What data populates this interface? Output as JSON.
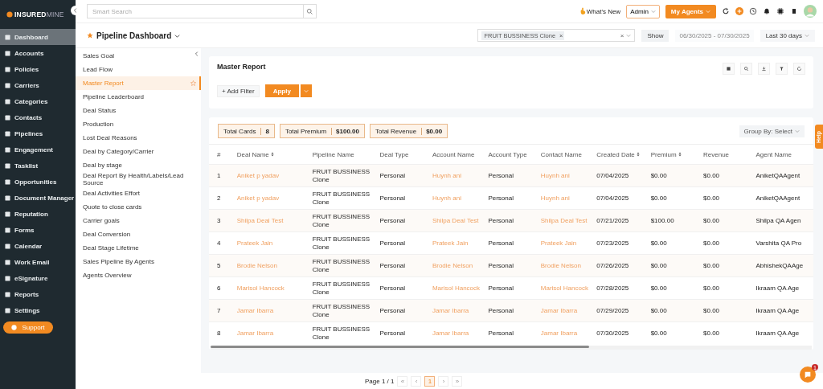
{
  "logo": {
    "bold": "INSURED",
    "light": "MINE"
  },
  "search": {
    "placeholder": "Smart Search"
  },
  "topbar": {
    "whats_new": "What's New",
    "role": "Admin",
    "agents_button": "My Agents"
  },
  "sidebar": {
    "items": [
      {
        "label": "Dashboard",
        "selected": true
      },
      {
        "label": "Accounts",
        "selected": false
      },
      {
        "label": "Policies",
        "selected": false
      },
      {
        "label": "Carriers",
        "selected": false
      },
      {
        "label": "Categories",
        "selected": false
      },
      {
        "label": "Contacts",
        "selected": false
      },
      {
        "label": "Pipelines",
        "selected": false
      },
      {
        "label": "Engagement",
        "selected": false
      },
      {
        "label": "Tasklist",
        "selected": false
      },
      {
        "label": "Opportunities",
        "selected": false
      },
      {
        "label": "Document Manager",
        "selected": false
      },
      {
        "label": "Reputation",
        "selected": false
      },
      {
        "label": "Forms",
        "selected": false
      },
      {
        "label": "Calendar",
        "selected": false
      },
      {
        "label": "Work Email",
        "selected": false
      },
      {
        "label": "eSignature",
        "selected": false
      },
      {
        "label": "Reports",
        "selected": false
      },
      {
        "label": "Settings",
        "selected": false
      }
    ],
    "support": "Support"
  },
  "header": {
    "title": "Pipeline Dashboard",
    "filter_tag": "FRUIT BUSSINESS Clone",
    "tag_remove": "×",
    "clear": "×",
    "show": "Show",
    "date_range": "06/30/2025 - 07/30/2025",
    "period": "Last 30 days"
  },
  "reports": [
    {
      "label": "Sales Goal",
      "selected": false,
      "starred": false
    },
    {
      "label": "Lead Flow",
      "selected": false,
      "starred": false
    },
    {
      "label": "Master Report",
      "selected": true,
      "starred": true
    },
    {
      "label": "Pipeline Leaderboard",
      "selected": false,
      "starred": false
    },
    {
      "label": "Deal Status",
      "selected": false,
      "starred": false
    },
    {
      "label": "Production",
      "selected": false,
      "starred": false
    },
    {
      "label": "Lost Deal Reasons",
      "selected": false,
      "starred": false
    },
    {
      "label": "Deal by Category/Carrier",
      "selected": false,
      "starred": false
    },
    {
      "label": "Deal by stage",
      "selected": false,
      "starred": false
    },
    {
      "label": "Deal Report By Health/Labels/Lead Source",
      "selected": false,
      "starred": false
    },
    {
      "label": "Deal Activities Effort",
      "selected": false,
      "starred": false
    },
    {
      "label": "Quote to close cards",
      "selected": false,
      "starred": false
    },
    {
      "label": "Carrier goals",
      "selected": false,
      "starred": false
    },
    {
      "label": "Deal Conversion",
      "selected": false,
      "starred": false
    },
    {
      "label": "Deal Stage Lifetime",
      "selected": false,
      "starred": false
    },
    {
      "label": "Sales Pipeline By Agents",
      "selected": false,
      "starred": false
    },
    {
      "label": "Agents Overview",
      "selected": false,
      "starred": false
    }
  ],
  "report": {
    "title": "Master Report",
    "add_filter": "+ Add Filter",
    "apply": "Apply"
  },
  "totals": [
    {
      "label": "Total Cards",
      "value": "8"
    },
    {
      "label": "Total Premium",
      "value": "$100.00"
    },
    {
      "label": "Total Revenue",
      "value": "$0.00"
    }
  ],
  "group_by": "Group By: Select",
  "help": "Help",
  "table": {
    "columns": [
      {
        "label": "#",
        "sortable": false
      },
      {
        "label": "Deal Name",
        "sortable": true
      },
      {
        "label": "Pipeline Name",
        "sortable": false
      },
      {
        "label": "Deal Type",
        "sortable": false
      },
      {
        "label": "Account Name",
        "sortable": false
      },
      {
        "label": "Account Type",
        "sortable": false
      },
      {
        "label": "Contact Name",
        "sortable": false
      },
      {
        "label": "Created Date",
        "sortable": true
      },
      {
        "label": "Premium",
        "sortable": true
      },
      {
        "label": "Revenue",
        "sortable": false
      },
      {
        "label": "Agent Name",
        "sortable": false
      }
    ],
    "rows": [
      [
        "1",
        "Aniket p yadav",
        "FRUIT BUSSINESS Clone",
        "Personal",
        "Huynh ani",
        "Personal",
        "Huynh ani",
        "07/04/2025",
        "$0.00",
        "$0.00",
        "AniketQAAgent"
      ],
      [
        "2",
        "Aniket p yadav",
        "FRUIT BUSSINESS Clone",
        "Personal",
        "Huynh ani",
        "Personal",
        "Huynh ani",
        "07/04/2025",
        "$0.00",
        "$0.00",
        "AniketQAAgent"
      ],
      [
        "3",
        "Shilpa Deal Test",
        "FRUIT BUSSINESS Clone",
        "Personal",
        "Shilpa Deal Test",
        "Personal",
        "Shilpa Deal Test",
        "07/21/2025",
        "$100.00",
        "$0.00",
        "Shilpa QA Agen"
      ],
      [
        "4",
        "Prateek Jain",
        "FRUIT BUSSINESS Clone",
        "Personal",
        "Prateek Jain",
        "Personal",
        "Prateek Jain",
        "07/23/2025",
        "$0.00",
        "$0.00",
        "Varshita QA Pro"
      ],
      [
        "5",
        "Brodie Nelson",
        "FRUIT BUSSINESS Clone",
        "Personal",
        "Brodie Nelson",
        "Personal",
        "Brodie Nelson",
        "07/26/2025",
        "$0.00",
        "$0.00",
        "AbhishekQAAge"
      ],
      [
        "6",
        "Marisol Hancock",
        "FRUIT BUSSINESS Clone",
        "Personal",
        "Marisol Hancock",
        "Personal",
        "Marisol Hancock",
        "07/28/2025",
        "$0.00",
        "$0.00",
        "Ikraam QA Age"
      ],
      [
        "7",
        "Jamar Ibarra",
        "FRUIT BUSSINESS Clone",
        "Personal",
        "Jamar Ibarra",
        "Personal",
        "Jamar Ibarra",
        "07/29/2025",
        "$0.00",
        "$0.00",
        "Ikraam QA Age"
      ],
      [
        "8",
        "Jamar Ibarra",
        "FRUIT BUSSINESS Clone",
        "Personal",
        "Jamar Ibarra",
        "Personal",
        "Jamar Ibarra",
        "07/30/2025",
        "$0.00",
        "$0.00",
        "Ikraam QA Age"
      ]
    ]
  },
  "pagination": {
    "label": "Page 1 / 1",
    "first": "«",
    "prev": "‹",
    "pages": [
      {
        "label": "1",
        "selected": true
      }
    ],
    "next": "›",
    "last": "»"
  },
  "chat_badge": "1"
}
